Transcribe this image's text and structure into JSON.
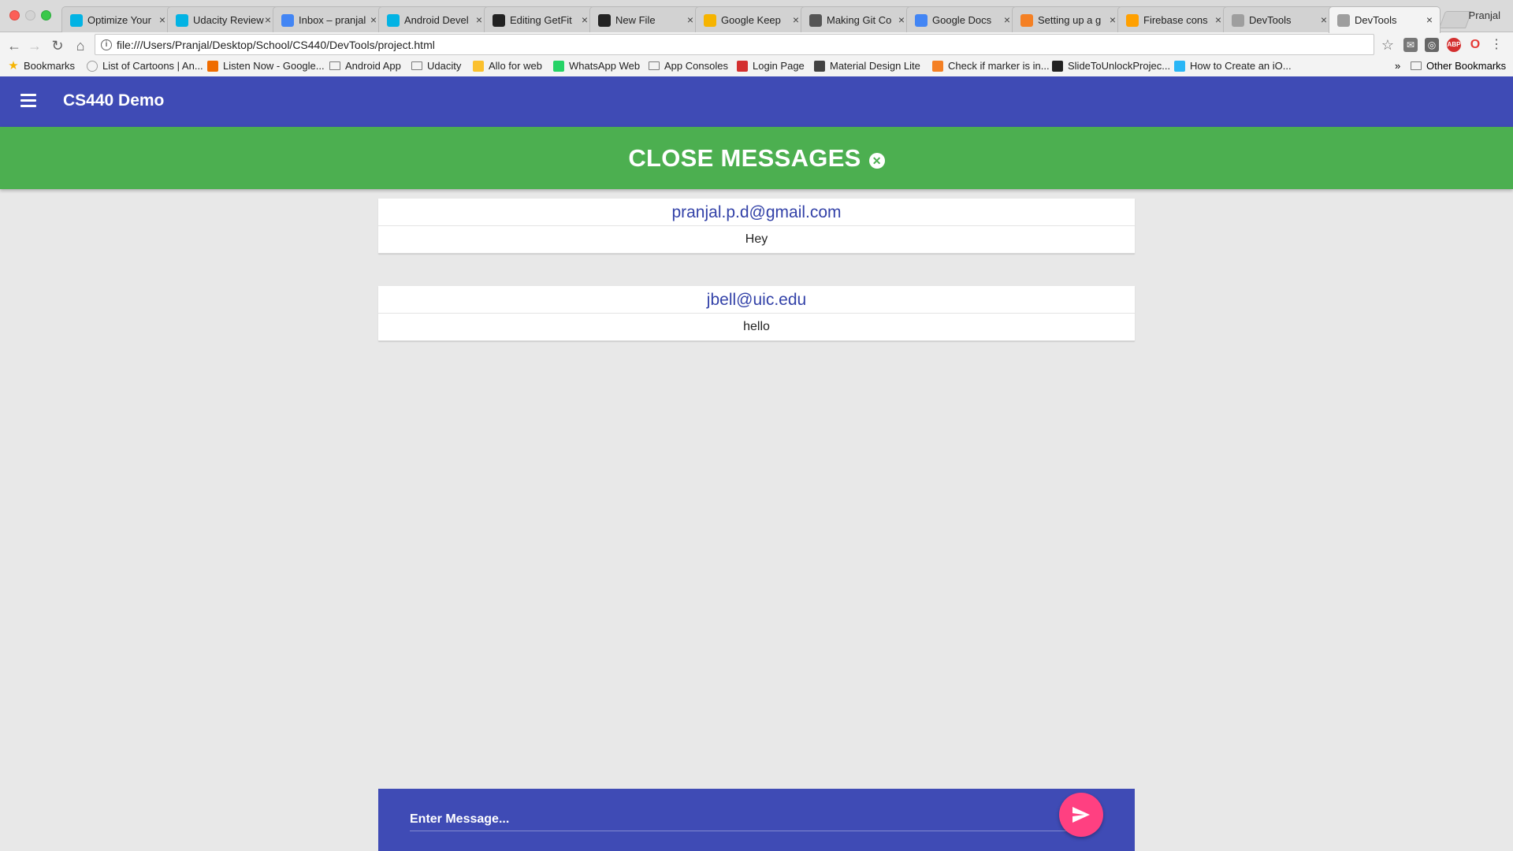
{
  "browser": {
    "profile_name": "Pranjal",
    "tabs": [
      {
        "label": "Optimize Your",
        "icon": "udacity-icon",
        "color": "#02b3e4"
      },
      {
        "label": "Udacity Review",
        "icon": "udacity-icon",
        "color": "#02b3e4"
      },
      {
        "label": "Inbox – pranjal",
        "icon": "inbox-icon",
        "color": "#4285f4"
      },
      {
        "label": "Android Devel",
        "icon": "udacity-icon",
        "color": "#02b3e4"
      },
      {
        "label": "Editing GetFit",
        "icon": "github-icon",
        "color": "#222222"
      },
      {
        "label": "New File",
        "icon": "github-icon",
        "color": "#222222"
      },
      {
        "label": "Google Keep",
        "icon": "keep-icon",
        "color": "#f6b400"
      },
      {
        "label": "Making Git Co",
        "icon": "loading-icon",
        "color": "#555555"
      },
      {
        "label": "Google Docs",
        "icon": "docs-icon",
        "color": "#4285f4"
      },
      {
        "label": "Setting up a g",
        "icon": "stackoverflow-icon",
        "color": "#f48024"
      },
      {
        "label": "Firebase cons",
        "icon": "firebase-icon",
        "color": "#ffa000"
      },
      {
        "label": "DevTools",
        "icon": "page-icon",
        "color": "#9e9e9e"
      },
      {
        "label": "DevTools",
        "icon": "page-icon",
        "color": "#9e9e9e",
        "active": true
      }
    ],
    "tab_close_glyph": "×",
    "url": "file:///Users/Pranjal/Desktop/School/CS440/DevTools/project.html",
    "bookmarks": [
      {
        "label": "Bookmarks",
        "icon": "star-icon",
        "color": "#f6b400"
      },
      {
        "label": "List of Cartoons | An...",
        "icon": "globe-icon",
        "color": "#9e9e9e"
      },
      {
        "label": "Listen Now - Google...",
        "icon": "play-music-icon",
        "color": "#ef6c00"
      },
      {
        "label": "Android App",
        "icon": "folder-icon",
        "color": "#7a7a7a"
      },
      {
        "label": "Udacity",
        "icon": "folder-icon",
        "color": "#7a7a7a"
      },
      {
        "label": "Allo for web",
        "icon": "allo-icon",
        "color": "#fbc02d"
      },
      {
        "label": "WhatsApp Web",
        "icon": "whatsapp-icon",
        "color": "#25d366"
      },
      {
        "label": "App Consoles",
        "icon": "folder-icon",
        "color": "#7a7a7a"
      },
      {
        "label": "Login Page",
        "icon": "angular-icon",
        "color": "#d32f2f"
      },
      {
        "label": "Material Design Lite",
        "icon": "mdl-icon",
        "color": "#424242"
      },
      {
        "label": "Check if marker is in...",
        "icon": "stackoverflow-icon",
        "color": "#f48024"
      },
      {
        "label": "SlideToUnlockProjec...",
        "icon": "github-icon",
        "color": "#222222"
      },
      {
        "label": "How to Create an iO...",
        "icon": "swift-icon",
        "color": "#29b6f6"
      }
    ],
    "overflow_label": "»",
    "other_bookmarks_label": "Other Bookmarks"
  },
  "app": {
    "title": "CS440 Demo",
    "close_messages_label": "CLOSE MESSAGES",
    "close_icon_glyph": "✕"
  },
  "messages": [
    {
      "sender": "pranjal.p.d@gmail.com",
      "text": "Hey"
    },
    {
      "sender": "jbell@uic.edu",
      "text": "hello"
    }
  ],
  "composer": {
    "placeholder": "Enter Message...",
    "value": ""
  },
  "colors": {
    "app_bar": "#3f4bb5",
    "banner": "#4caf50",
    "send_button": "#ff4081",
    "sender_text": "#3342a8"
  }
}
